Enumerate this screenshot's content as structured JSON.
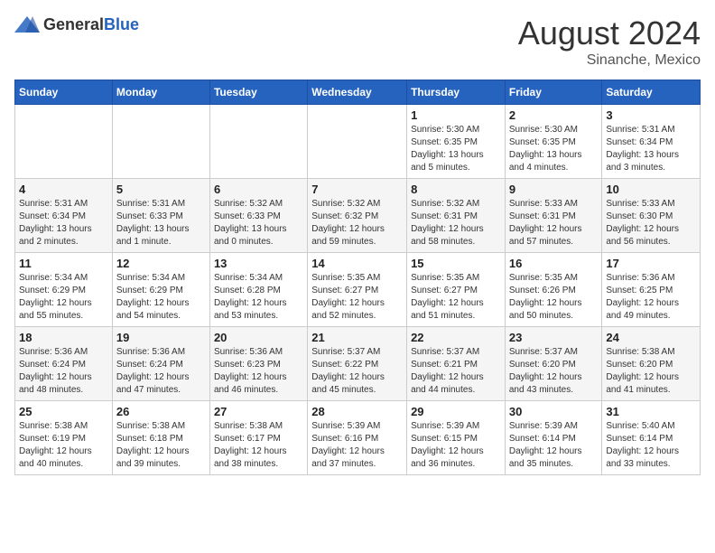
{
  "header": {
    "logo_general": "General",
    "logo_blue": "Blue",
    "month_year": "August 2024",
    "location": "Sinanche, Mexico"
  },
  "days_of_week": [
    "Sunday",
    "Monday",
    "Tuesday",
    "Wednesday",
    "Thursday",
    "Friday",
    "Saturday"
  ],
  "weeks": [
    [
      {
        "day": "",
        "info": ""
      },
      {
        "day": "",
        "info": ""
      },
      {
        "day": "",
        "info": ""
      },
      {
        "day": "",
        "info": ""
      },
      {
        "day": "1",
        "info": "Sunrise: 5:30 AM\nSunset: 6:35 PM\nDaylight: 13 hours\nand 5 minutes."
      },
      {
        "day": "2",
        "info": "Sunrise: 5:30 AM\nSunset: 6:35 PM\nDaylight: 13 hours\nand 4 minutes."
      },
      {
        "day": "3",
        "info": "Sunrise: 5:31 AM\nSunset: 6:34 PM\nDaylight: 13 hours\nand 3 minutes."
      }
    ],
    [
      {
        "day": "4",
        "info": "Sunrise: 5:31 AM\nSunset: 6:34 PM\nDaylight: 13 hours\nand 2 minutes."
      },
      {
        "day": "5",
        "info": "Sunrise: 5:31 AM\nSunset: 6:33 PM\nDaylight: 13 hours\nand 1 minute."
      },
      {
        "day": "6",
        "info": "Sunrise: 5:32 AM\nSunset: 6:33 PM\nDaylight: 13 hours\nand 0 minutes."
      },
      {
        "day": "7",
        "info": "Sunrise: 5:32 AM\nSunset: 6:32 PM\nDaylight: 12 hours\nand 59 minutes."
      },
      {
        "day": "8",
        "info": "Sunrise: 5:32 AM\nSunset: 6:31 PM\nDaylight: 12 hours\nand 58 minutes."
      },
      {
        "day": "9",
        "info": "Sunrise: 5:33 AM\nSunset: 6:31 PM\nDaylight: 12 hours\nand 57 minutes."
      },
      {
        "day": "10",
        "info": "Sunrise: 5:33 AM\nSunset: 6:30 PM\nDaylight: 12 hours\nand 56 minutes."
      }
    ],
    [
      {
        "day": "11",
        "info": "Sunrise: 5:34 AM\nSunset: 6:29 PM\nDaylight: 12 hours\nand 55 minutes."
      },
      {
        "day": "12",
        "info": "Sunrise: 5:34 AM\nSunset: 6:29 PM\nDaylight: 12 hours\nand 54 minutes."
      },
      {
        "day": "13",
        "info": "Sunrise: 5:34 AM\nSunset: 6:28 PM\nDaylight: 12 hours\nand 53 minutes."
      },
      {
        "day": "14",
        "info": "Sunrise: 5:35 AM\nSunset: 6:27 PM\nDaylight: 12 hours\nand 52 minutes."
      },
      {
        "day": "15",
        "info": "Sunrise: 5:35 AM\nSunset: 6:27 PM\nDaylight: 12 hours\nand 51 minutes."
      },
      {
        "day": "16",
        "info": "Sunrise: 5:35 AM\nSunset: 6:26 PM\nDaylight: 12 hours\nand 50 minutes."
      },
      {
        "day": "17",
        "info": "Sunrise: 5:36 AM\nSunset: 6:25 PM\nDaylight: 12 hours\nand 49 minutes."
      }
    ],
    [
      {
        "day": "18",
        "info": "Sunrise: 5:36 AM\nSunset: 6:24 PM\nDaylight: 12 hours\nand 48 minutes."
      },
      {
        "day": "19",
        "info": "Sunrise: 5:36 AM\nSunset: 6:24 PM\nDaylight: 12 hours\nand 47 minutes."
      },
      {
        "day": "20",
        "info": "Sunrise: 5:36 AM\nSunset: 6:23 PM\nDaylight: 12 hours\nand 46 minutes."
      },
      {
        "day": "21",
        "info": "Sunrise: 5:37 AM\nSunset: 6:22 PM\nDaylight: 12 hours\nand 45 minutes."
      },
      {
        "day": "22",
        "info": "Sunrise: 5:37 AM\nSunset: 6:21 PM\nDaylight: 12 hours\nand 44 minutes."
      },
      {
        "day": "23",
        "info": "Sunrise: 5:37 AM\nSunset: 6:20 PM\nDaylight: 12 hours\nand 43 minutes."
      },
      {
        "day": "24",
        "info": "Sunrise: 5:38 AM\nSunset: 6:20 PM\nDaylight: 12 hours\nand 41 minutes."
      }
    ],
    [
      {
        "day": "25",
        "info": "Sunrise: 5:38 AM\nSunset: 6:19 PM\nDaylight: 12 hours\nand 40 minutes."
      },
      {
        "day": "26",
        "info": "Sunrise: 5:38 AM\nSunset: 6:18 PM\nDaylight: 12 hours\nand 39 minutes."
      },
      {
        "day": "27",
        "info": "Sunrise: 5:38 AM\nSunset: 6:17 PM\nDaylight: 12 hours\nand 38 minutes."
      },
      {
        "day": "28",
        "info": "Sunrise: 5:39 AM\nSunset: 6:16 PM\nDaylight: 12 hours\nand 37 minutes."
      },
      {
        "day": "29",
        "info": "Sunrise: 5:39 AM\nSunset: 6:15 PM\nDaylight: 12 hours\nand 36 minutes."
      },
      {
        "day": "30",
        "info": "Sunrise: 5:39 AM\nSunset: 6:14 PM\nDaylight: 12 hours\nand 35 minutes."
      },
      {
        "day": "31",
        "info": "Sunrise: 5:40 AM\nSunset: 6:14 PM\nDaylight: 12 hours\nand 33 minutes."
      }
    ]
  ]
}
